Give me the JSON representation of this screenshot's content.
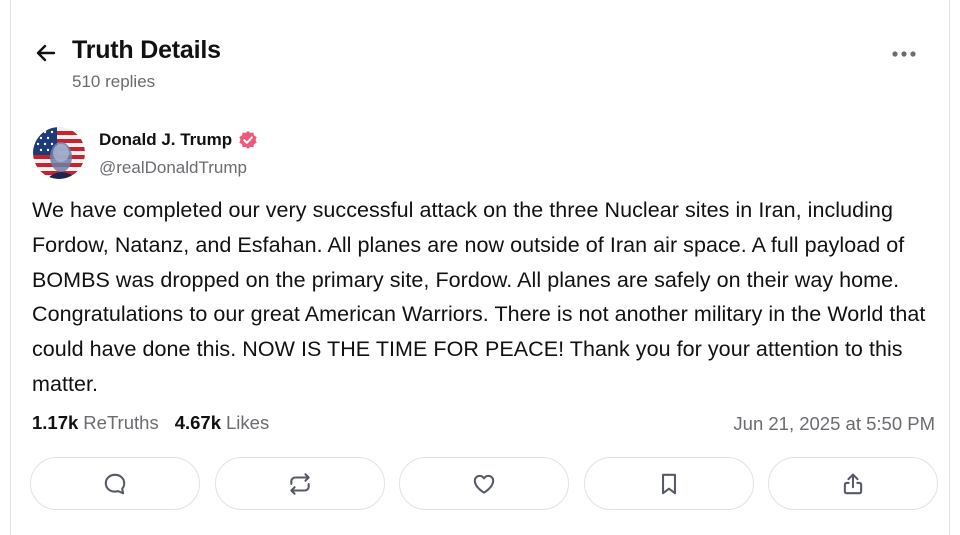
{
  "header": {
    "title": "Truth Details",
    "replies": "510 replies"
  },
  "author": {
    "name": "Donald J. Trump",
    "handle": "@realDonaldTrump",
    "verified": true,
    "verified_color": "#f0577a"
  },
  "post": {
    "text": "We have completed our very successful attack on the three Nuclear sites in Iran, including Fordow, Natanz, and Esfahan. All planes are now outside of Iran air space. A full payload of BOMBS was dropped on the primary site, Fordow. All planes are safely on their way home. Congratulations to our great American Warriors. There is not another military in the World that could have done this. NOW IS THE TIME FOR PEACE! Thank you for your attention to this matter."
  },
  "stats": {
    "retruths_count": "1.17k",
    "retruths_label": "ReTruths",
    "likes_count": "4.67k",
    "likes_label": "Likes",
    "timestamp": "Jun 21, 2025 at 5:50 PM"
  },
  "actions": [
    {
      "icon": "reply-icon"
    },
    {
      "icon": "retruth-icon"
    },
    {
      "icon": "like-icon"
    },
    {
      "icon": "bookmark-icon"
    },
    {
      "icon": "share-icon"
    }
  ],
  "colors": {
    "text": "#111111",
    "muted": "#6b6b70",
    "border": "#e2e2e6"
  }
}
